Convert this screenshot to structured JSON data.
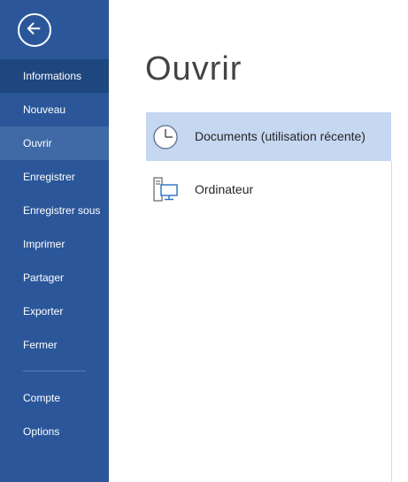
{
  "sidebar": {
    "items": [
      {
        "label": "Informations"
      },
      {
        "label": "Nouveau"
      },
      {
        "label": "Ouvrir"
      },
      {
        "label": "Enregistrer"
      },
      {
        "label": "Enregistrer sous"
      },
      {
        "label": "Imprimer"
      },
      {
        "label": "Partager"
      },
      {
        "label": "Exporter"
      },
      {
        "label": "Fermer"
      },
      {
        "label": "Compte"
      },
      {
        "label": "Options"
      }
    ],
    "selected": "Ouvrir",
    "back_icon": "back-arrow-icon"
  },
  "main": {
    "title": "Ouvrir",
    "options": [
      {
        "label": "Documents (utilisation récente)",
        "icon": "clock-icon",
        "selected": true
      },
      {
        "label": "Ordinateur",
        "icon": "computer-icon",
        "selected": false
      }
    ]
  },
  "colors": {
    "sidebar_bg": "#2b579a",
    "sidebar_active": "#1f477f",
    "sidebar_selected": "#3f6aa6",
    "option_selected_bg": "#c5d7f1"
  }
}
